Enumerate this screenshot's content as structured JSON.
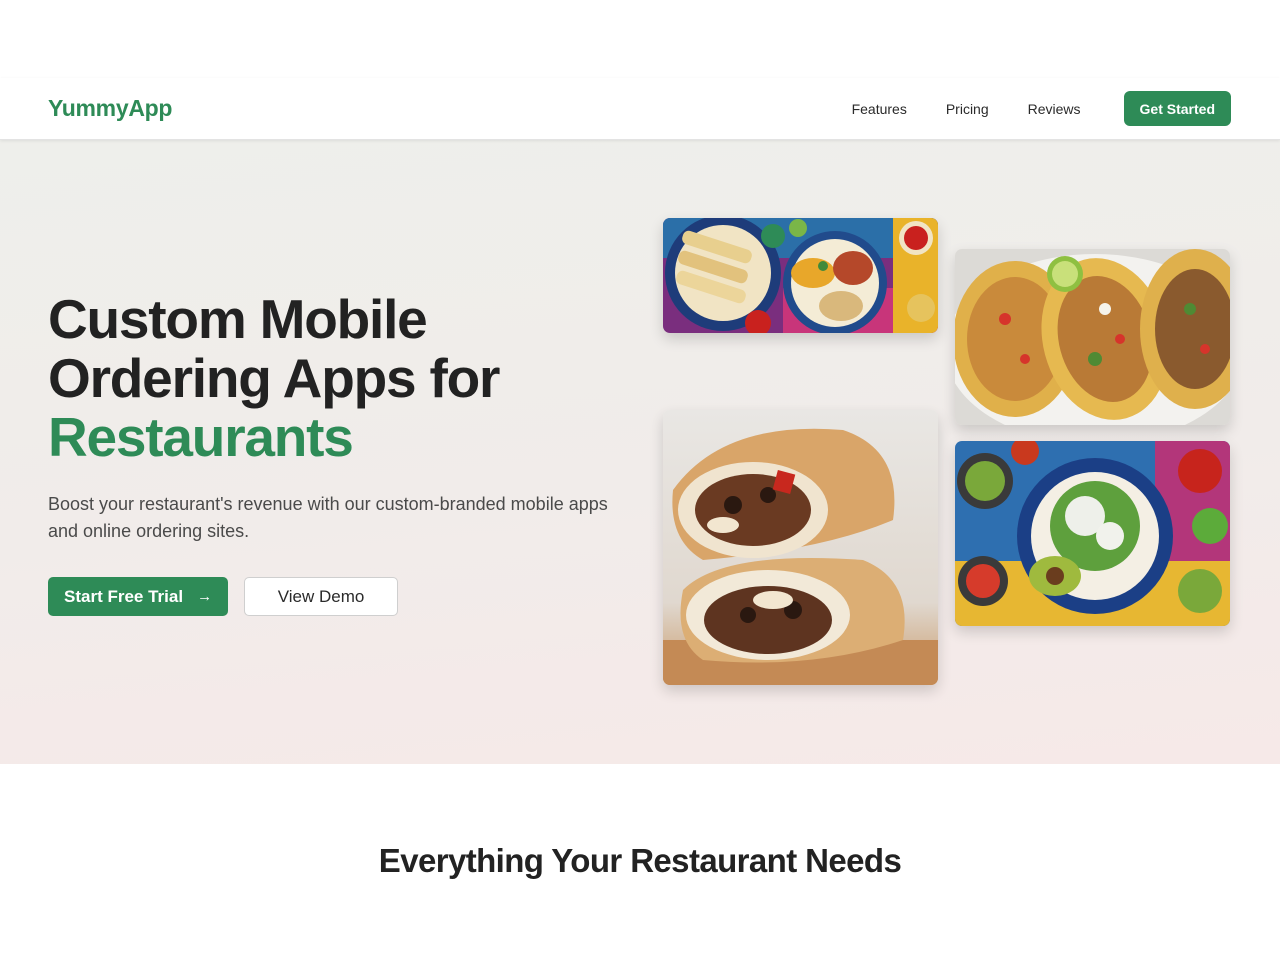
{
  "brand": {
    "name": "YummyApp"
  },
  "nav": {
    "links": [
      "Features",
      "Pricing",
      "Reviews"
    ],
    "cta": "Get Started"
  },
  "hero": {
    "title_line1": "Custom Mobile",
    "title_line2": "Ordering Apps for",
    "title_accent": "Restaurants",
    "subtitle": "Boost your restaurant's revenue with our custom-branded mobile apps and online ordering sites.",
    "primary_button": "Start Free Trial",
    "secondary_button": "View Demo"
  },
  "features_section": {
    "title": "Everything Your Restaurant Needs"
  },
  "colors": {
    "accent": "#2e8b57",
    "heading": "#222222",
    "body_text": "#4a4a4a"
  },
  "icons": {
    "primary_button_icon": "arrow-right-icon"
  }
}
